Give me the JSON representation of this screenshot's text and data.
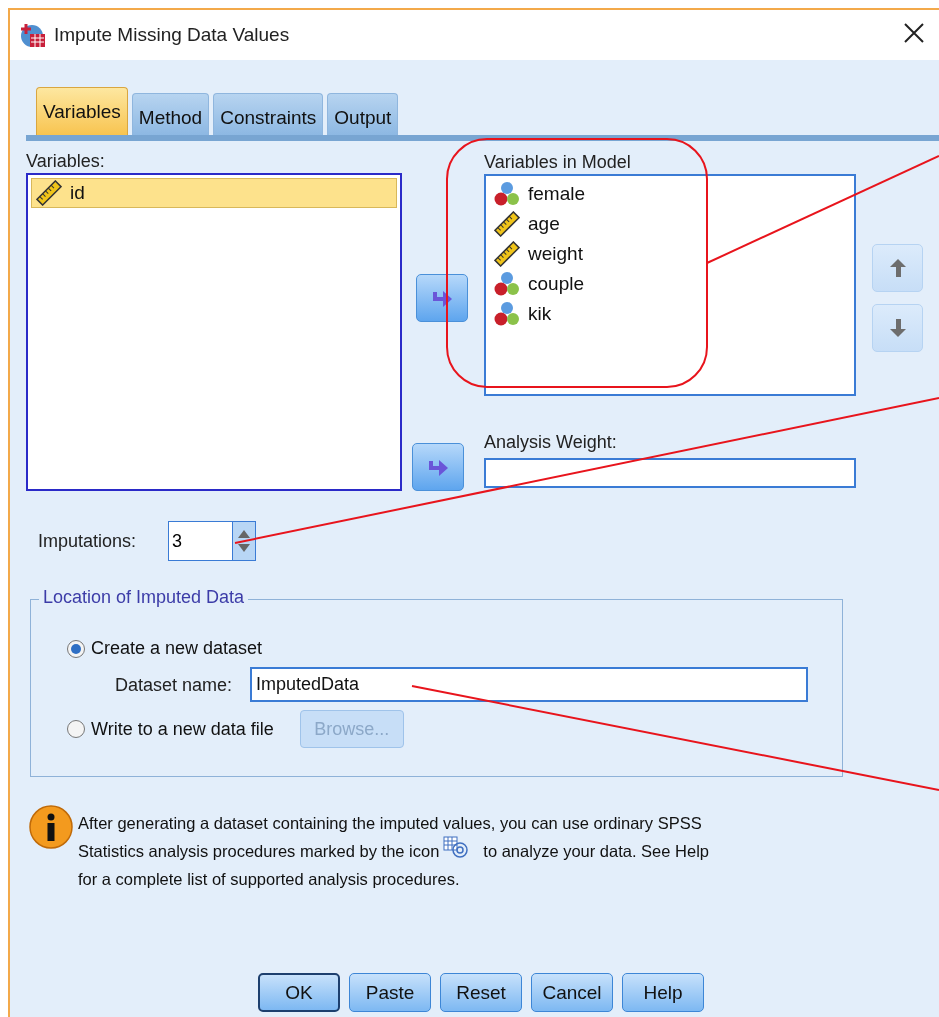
{
  "window": {
    "title": "Impute Missing Data Values"
  },
  "tabs": [
    {
      "label": "Variables",
      "selected": true
    },
    {
      "label": "Method",
      "selected": false
    },
    {
      "label": "Constraints",
      "selected": false
    },
    {
      "label": "Output",
      "selected": false
    }
  ],
  "variables": {
    "label": "Variables:",
    "items": [
      {
        "name": "id",
        "kind": "scale",
        "selected": true
      }
    ]
  },
  "model": {
    "label": "Variables in Model",
    "items": [
      {
        "name": "female",
        "kind": "nominal",
        "selected": false
      },
      {
        "name": "age",
        "kind": "scale",
        "selected": false
      },
      {
        "name": "weight",
        "kind": "scale",
        "selected": false
      },
      {
        "name": "couple",
        "kind": "nominal",
        "selected": false
      },
      {
        "name": "kik",
        "kind": "nominal",
        "selected": false
      }
    ]
  },
  "reorder": [
    {
      "kind": "up",
      "disabled": true
    },
    {
      "kind": "down",
      "disabled": true
    }
  ],
  "analysis_weight": {
    "label": "Analysis Weight:"
  },
  "imputations": {
    "label": "Imputations:",
    "value": "3"
  },
  "location": {
    "title": "Location of Imputed Data",
    "options": [
      {
        "label": "Create a new dataset",
        "selected": true
      },
      {
        "label": "Write to a new data file",
        "selected": false
      }
    ],
    "dataset_name": {
      "label": "Dataset name:",
      "value": "ImputedData"
    },
    "browse": {
      "label": "Browse...",
      "disabled": true
    }
  },
  "info": {
    "line_1": "After generating a dataset containing the imputed values, you can use ordinary SPSS",
    "line_2_before_icon": "Statistics analysis procedures marked by the icon",
    "line_2_after_icon": "to analyze your data. See Help",
    "line_3": "for a complete list of supported analysis procedures."
  },
  "buttons": [
    {
      "label": "OK",
      "default": true
    },
    {
      "label": "Paste",
      "default": false
    },
    {
      "label": "Reset",
      "default": false
    },
    {
      "label": "Cancel",
      "default": false
    },
    {
      "label": "Help",
      "default": false
    }
  ]
}
